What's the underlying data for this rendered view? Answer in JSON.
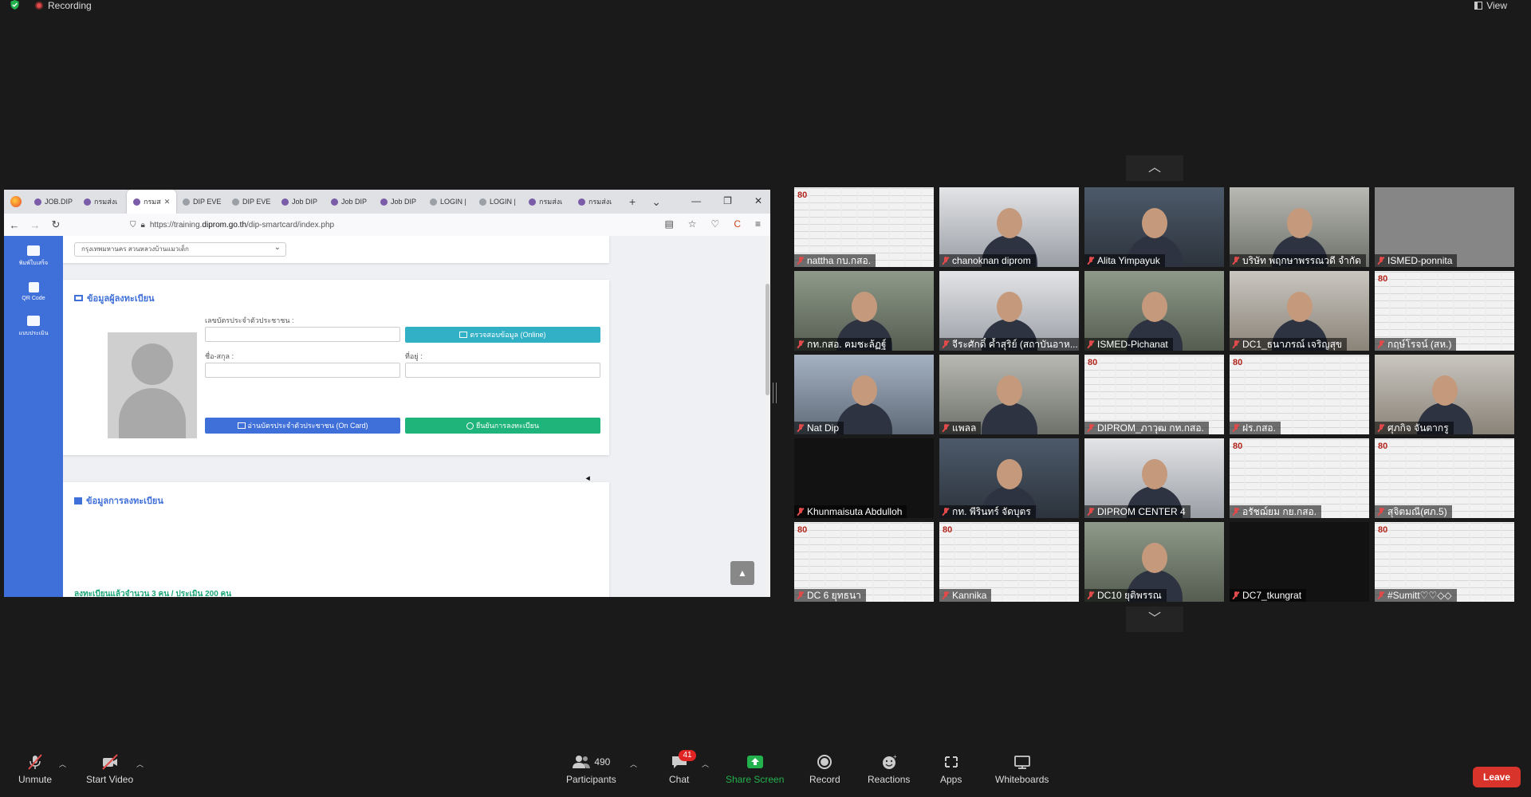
{
  "zoom_top": {
    "recording": "Recording",
    "view": "View"
  },
  "browser": {
    "tabs": [
      "JOB.DIP",
      "กรมส่งเ",
      "กรมส",
      "DIP EVE",
      "DIP EVE",
      "Job DIP",
      "Job DIP",
      "Job DIP",
      "LOGIN |",
      "LOGIN |",
      "กรมส่งเ",
      "กรมส่งเ"
    ],
    "active_tab_index": 2,
    "url_prefix": "https://training.",
    "url_host": "diprom.go.th",
    "url_path": "/dip-smartcard/index.php"
  },
  "site": {
    "sidebar": [
      {
        "label": "พิมพ์ใบเสร็จ",
        "icon": "printer-icon"
      },
      {
        "label": "QR Code",
        "icon": "qr-code-icon"
      },
      {
        "label": "แบบประเมิน",
        "icon": "form-icon"
      }
    ],
    "location_select": "กรุงเทพมหานคร สวนหลวงบ้านแมวเด็ก",
    "registrant_title": "ข้อมูลผู้ลงทะเบียน",
    "id_label": "เลขบัตรประจำตัวประชาชน :",
    "check_online_btn": "ตรวจสอบข้อมูล (Online)",
    "name_label": "ชื่อ-สกุล :",
    "address_label": "ที่อยู่ :",
    "read_card_btn": "อ่านบัตรประจำตัวประชาชน (On Card)",
    "confirm_btn": "ยืนยันการลงทะเบียน",
    "registration_title": "ข้อมูลการลงทะเบียน",
    "registration_summary": "ลงทะเบียนแล้วจำนวน 3 คน / ประเมิน 200 คน",
    "colors": {
      "sidebar": "#3f6fd8",
      "info": "#31b0c6",
      "primary": "#3f6fd8",
      "success": "#1fb57a"
    }
  },
  "participants": [
    {
      "name": "nattha กบ.กสอ.",
      "bg": "doc"
    },
    {
      "name": "chanoknan diprom",
      "bg": "cam-b"
    },
    {
      "name": "Alita Yimpayuk",
      "bg": "cam-c"
    },
    {
      "name": "บริษัท พฤกษาพรรณวดี จำกัด",
      "bg": "cam-e"
    },
    {
      "name": "ISMED-ponnita",
      "bg": "plain"
    },
    {
      "name": "กท.กสอ. ฅมชะล้ฏฐ์",
      "bg": "cam-d"
    },
    {
      "name": "จีระศักดิ์ ค้ำสุริย์ (สถาบันอาห...",
      "bg": "cam-b"
    },
    {
      "name": "ISMED-Pichanat",
      "bg": "cam-d"
    },
    {
      "name": "DC1_ธนาภรณ์ เจริญสุข",
      "bg": "cam-a"
    },
    {
      "name": "กฤษ์โรจน์ (สห.)",
      "bg": "doc"
    },
    {
      "name": "Nat Dip",
      "bg": "cam-f"
    },
    {
      "name": "แพลล",
      "bg": "cam-e"
    },
    {
      "name": "DIPROM_ภาวุฒ กท.กสอ.",
      "bg": "doc"
    },
    {
      "name": "ฝร.กสอ.",
      "bg": "doc"
    },
    {
      "name": "ศุภกิจ จันตากรู",
      "bg": "cam-a"
    },
    {
      "name": "Khunmaisuta Abdulloh",
      "bg": "dark"
    },
    {
      "name": "กท. พีรินทร์ จัดบุตร",
      "bg": "cam-c"
    },
    {
      "name": "DIPROM CENTER 4",
      "bg": "cam-b"
    },
    {
      "name": "อรัชฌ์ยม กย.กสอ.",
      "bg": "doc"
    },
    {
      "name": "สุจิตมณี(ศภ.5)",
      "bg": "doc"
    },
    {
      "name": "DC 6 ยุทธนา",
      "bg": "doc"
    },
    {
      "name": "Kannika",
      "bg": "doc"
    },
    {
      "name": "DC10 ยุติพรรณ",
      "bg": "cam-d"
    },
    {
      "name": "DC7_tkungrat",
      "bg": "dark"
    },
    {
      "name": "#Sumitt♡♡◇◇",
      "bg": "doc"
    }
  ],
  "toolbar": {
    "unmute": "Unmute",
    "start_video": "Start Video",
    "participants_count": "490",
    "participants": "Participants",
    "chat_badge": "41",
    "chat": "Chat",
    "share_screen": "Share Screen",
    "record": "Record",
    "reactions": "Reactions",
    "apps": "Apps",
    "whiteboards": "Whiteboards",
    "leave": "Leave"
  }
}
